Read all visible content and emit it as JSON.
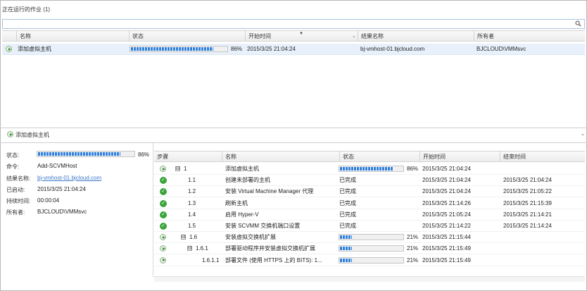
{
  "panel_title": "正在运行的作业 (1)",
  "search": {
    "placeholder": ""
  },
  "jobs_grid": {
    "columns": [
      "名称",
      "状态",
      "开始时间",
      "结果名称",
      "所有者"
    ],
    "rows": [
      {
        "name": "添加虚拟主机",
        "progress": 0.86,
        "progress_text": "86%",
        "start_time": "2015/3/25 21:04:24",
        "result_name": "bj-vmhost-01.bjcloud.com",
        "owner": "BJCLOUD\\VMMsvc"
      }
    ]
  },
  "details": {
    "title": "添加虚拟主机",
    "labels": {
      "status": "状态:",
      "command": "命令:",
      "result_name": "结果名称:",
      "started": "已启动:",
      "duration": "持续时间:",
      "owner": "所有者:"
    },
    "status_progress": 0.86,
    "status_text": "86%",
    "command": "Add-SCVMHost",
    "result_name": "bj-vmhost-01.bjcloud.com",
    "started": "2015/3/25 21:04:24",
    "duration": "00:00:04",
    "owner": "BJCLOUD\\VMMsvc"
  },
  "steps_grid": {
    "columns": [
      "步骤",
      "名称",
      "状态",
      "开始时间",
      "结束时间"
    ],
    "rows": [
      {
        "icon": "play",
        "expander": "⊟",
        "step": "1",
        "name": "添加虚拟主机",
        "progress": 0.86,
        "status": "86%",
        "start": "2015/3/25 21:04:24",
        "end": ""
      },
      {
        "icon": "check",
        "expander": "",
        "step": "1.1",
        "name": "创建未部署的主机",
        "progress": null,
        "status": "已完成",
        "start": "2015/3/25 21:04:24",
        "end": "2015/3/25 21:04:24"
      },
      {
        "icon": "check",
        "expander": "",
        "step": "1.2",
        "name": "安装 Virtual Machine Manager 代理",
        "progress": null,
        "status": "已完成",
        "start": "2015/3/25 21:04:24",
        "end": "2015/3/25 21:05:22"
      },
      {
        "icon": "check",
        "expander": "",
        "step": "1.3",
        "name": "刷新主机",
        "progress": null,
        "status": "已完成",
        "start": "2015/3/25 21:14:26",
        "end": "2015/3/25 21:15:39"
      },
      {
        "icon": "check",
        "expander": "",
        "step": "1.4",
        "name": "启用 Hyper-V",
        "progress": null,
        "status": "已完成",
        "start": "2015/3/25 21:05:24",
        "end": "2015/3/25 21:14:21"
      },
      {
        "icon": "check",
        "expander": "",
        "step": "1.5",
        "name": "安装 SCVMM 交换机端口设置",
        "progress": null,
        "status": "已完成",
        "start": "2015/3/25 21:14:22",
        "end": "2015/3/25 21:14:24"
      },
      {
        "icon": "play",
        "expander": "⊟",
        "step": "1.6",
        "name": "安装虚拟交换机扩展",
        "progress": 0.21,
        "status": "21%",
        "start": "2015/3/25 21:15:44",
        "end": ""
      },
      {
        "icon": "play",
        "expander": "⊟",
        "step": "1.6.1",
        "name": "部署驱动程序并安装虚拟交换机扩展",
        "progress": 0.21,
        "status": "21%",
        "start": "2015/3/25 21:15:49",
        "end": ""
      },
      {
        "icon": "play",
        "expander": "",
        "step": "1.6.1.1",
        "name": "部署文件 (使用  HTTPS 上的 BITS): 1...",
        "progress": 0.21,
        "status": "21%",
        "start": "2015/3/25 21:15:49",
        "end": ""
      }
    ]
  }
}
